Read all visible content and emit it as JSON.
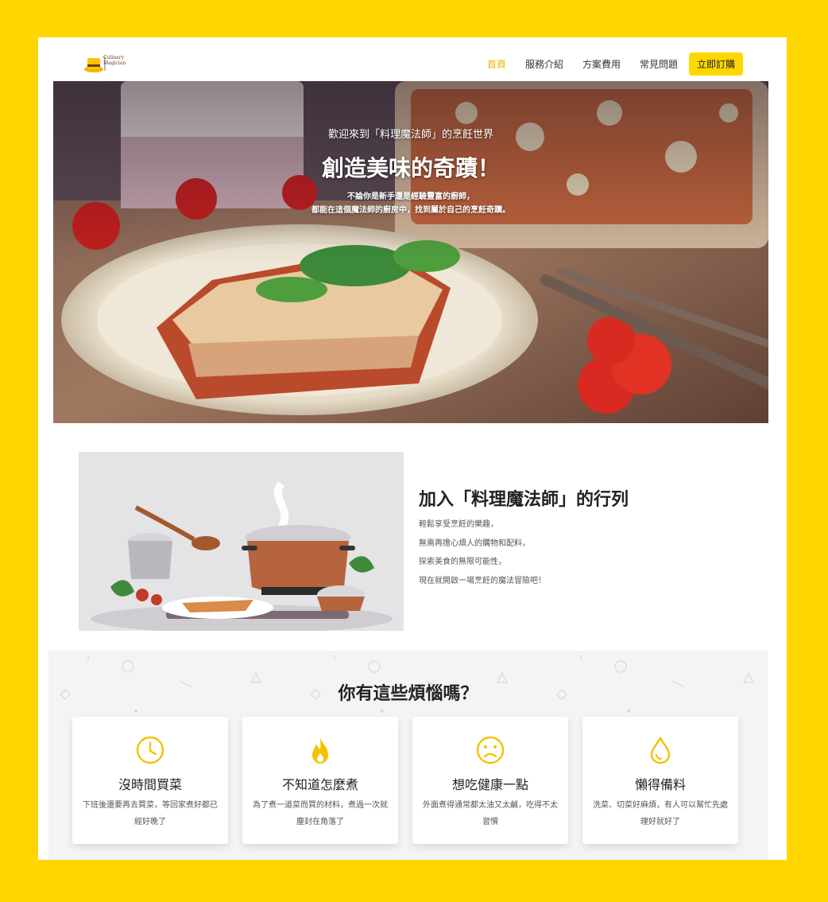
{
  "brand": {
    "logo_text": "Culinary Magician"
  },
  "nav": {
    "links": [
      "首頁",
      "服務介紹",
      "方案費用",
      "常見問題"
    ],
    "cta": "立即訂購"
  },
  "hero": {
    "subtitle": "歡迎來到「料理魔法師」的烹飪世界",
    "title": "創造美味的奇蹟！",
    "desc_line1": "不論你是新手還是經驗豐富的廚師，",
    "desc_line2": "都能在這個魔法師的廚房中，找到屬於自己的烹飪奇蹟。"
  },
  "join": {
    "title": "加入「料理魔法師」的行列",
    "lines": [
      "輕鬆享受烹飪的樂趣，",
      "無需再擔心煩人的購物和配料，",
      "探索美食的無限可能性，",
      "現在就開啟一場烹飪的魔法冒險吧！"
    ]
  },
  "worries": {
    "title": "你有這些煩惱嗎？",
    "cards": [
      {
        "icon": "clock-icon",
        "title": "沒時間買菜",
        "desc": "下班後還要再去買菜，等回家煮好都已經好晚了"
      },
      {
        "icon": "fire-icon",
        "title": "不知道怎麼煮",
        "desc": "為了煮一道菜而買的材料，煮過一次就塵封在角落了"
      },
      {
        "icon": "sad-face-icon",
        "title": "想吃健康一點",
        "desc": "外面煮得通常都太油又太鹹，吃得不太習慣"
      },
      {
        "icon": "droplet-icon",
        "title": "懶得備料",
        "desc": "洗菜、切菜好麻煩，有人可以幫忙先處理好就好了"
      }
    ]
  },
  "colors": {
    "accent": "#FFD600",
    "active_link": "#F2B400",
    "icon": "#F2C200"
  }
}
